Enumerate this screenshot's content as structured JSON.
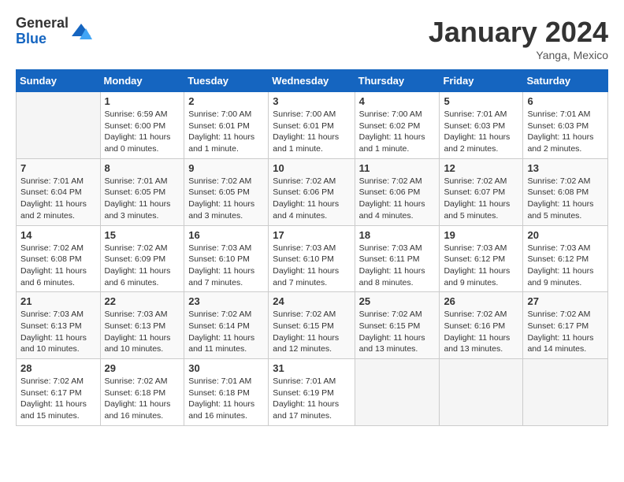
{
  "logo": {
    "general": "General",
    "blue": "Blue"
  },
  "title": "January 2024",
  "location": "Yanga, Mexico",
  "days_of_week": [
    "Sunday",
    "Monday",
    "Tuesday",
    "Wednesday",
    "Thursday",
    "Friday",
    "Saturday"
  ],
  "weeks": [
    [
      {
        "day": "",
        "info": ""
      },
      {
        "day": "1",
        "info": "Sunrise: 6:59 AM\nSunset: 6:00 PM\nDaylight: 11 hours\nand 0 minutes."
      },
      {
        "day": "2",
        "info": "Sunrise: 7:00 AM\nSunset: 6:01 PM\nDaylight: 11 hours\nand 1 minute."
      },
      {
        "day": "3",
        "info": "Sunrise: 7:00 AM\nSunset: 6:01 PM\nDaylight: 11 hours\nand 1 minute."
      },
      {
        "day": "4",
        "info": "Sunrise: 7:00 AM\nSunset: 6:02 PM\nDaylight: 11 hours\nand 1 minute."
      },
      {
        "day": "5",
        "info": "Sunrise: 7:01 AM\nSunset: 6:03 PM\nDaylight: 11 hours\nand 2 minutes."
      },
      {
        "day": "6",
        "info": "Sunrise: 7:01 AM\nSunset: 6:03 PM\nDaylight: 11 hours\nand 2 minutes."
      }
    ],
    [
      {
        "day": "7",
        "info": "Sunrise: 7:01 AM\nSunset: 6:04 PM\nDaylight: 11 hours\nand 2 minutes."
      },
      {
        "day": "8",
        "info": "Sunrise: 7:01 AM\nSunset: 6:05 PM\nDaylight: 11 hours\nand 3 minutes."
      },
      {
        "day": "9",
        "info": "Sunrise: 7:02 AM\nSunset: 6:05 PM\nDaylight: 11 hours\nand 3 minutes."
      },
      {
        "day": "10",
        "info": "Sunrise: 7:02 AM\nSunset: 6:06 PM\nDaylight: 11 hours\nand 4 minutes."
      },
      {
        "day": "11",
        "info": "Sunrise: 7:02 AM\nSunset: 6:06 PM\nDaylight: 11 hours\nand 4 minutes."
      },
      {
        "day": "12",
        "info": "Sunrise: 7:02 AM\nSunset: 6:07 PM\nDaylight: 11 hours\nand 5 minutes."
      },
      {
        "day": "13",
        "info": "Sunrise: 7:02 AM\nSunset: 6:08 PM\nDaylight: 11 hours\nand 5 minutes."
      }
    ],
    [
      {
        "day": "14",
        "info": "Sunrise: 7:02 AM\nSunset: 6:08 PM\nDaylight: 11 hours\nand 6 minutes."
      },
      {
        "day": "15",
        "info": "Sunrise: 7:02 AM\nSunset: 6:09 PM\nDaylight: 11 hours\nand 6 minutes."
      },
      {
        "day": "16",
        "info": "Sunrise: 7:03 AM\nSunset: 6:10 PM\nDaylight: 11 hours\nand 7 minutes."
      },
      {
        "day": "17",
        "info": "Sunrise: 7:03 AM\nSunset: 6:10 PM\nDaylight: 11 hours\nand 7 minutes."
      },
      {
        "day": "18",
        "info": "Sunrise: 7:03 AM\nSunset: 6:11 PM\nDaylight: 11 hours\nand 8 minutes."
      },
      {
        "day": "19",
        "info": "Sunrise: 7:03 AM\nSunset: 6:12 PM\nDaylight: 11 hours\nand 9 minutes."
      },
      {
        "day": "20",
        "info": "Sunrise: 7:03 AM\nSunset: 6:12 PM\nDaylight: 11 hours\nand 9 minutes."
      }
    ],
    [
      {
        "day": "21",
        "info": "Sunrise: 7:03 AM\nSunset: 6:13 PM\nDaylight: 11 hours\nand 10 minutes."
      },
      {
        "day": "22",
        "info": "Sunrise: 7:03 AM\nSunset: 6:13 PM\nDaylight: 11 hours\nand 10 minutes."
      },
      {
        "day": "23",
        "info": "Sunrise: 7:02 AM\nSunset: 6:14 PM\nDaylight: 11 hours\nand 11 minutes."
      },
      {
        "day": "24",
        "info": "Sunrise: 7:02 AM\nSunset: 6:15 PM\nDaylight: 11 hours\nand 12 minutes."
      },
      {
        "day": "25",
        "info": "Sunrise: 7:02 AM\nSunset: 6:15 PM\nDaylight: 11 hours\nand 13 minutes."
      },
      {
        "day": "26",
        "info": "Sunrise: 7:02 AM\nSunset: 6:16 PM\nDaylight: 11 hours\nand 13 minutes."
      },
      {
        "day": "27",
        "info": "Sunrise: 7:02 AM\nSunset: 6:17 PM\nDaylight: 11 hours\nand 14 minutes."
      }
    ],
    [
      {
        "day": "28",
        "info": "Sunrise: 7:02 AM\nSunset: 6:17 PM\nDaylight: 11 hours\nand 15 minutes."
      },
      {
        "day": "29",
        "info": "Sunrise: 7:02 AM\nSunset: 6:18 PM\nDaylight: 11 hours\nand 16 minutes."
      },
      {
        "day": "30",
        "info": "Sunrise: 7:01 AM\nSunset: 6:18 PM\nDaylight: 11 hours\nand 16 minutes."
      },
      {
        "day": "31",
        "info": "Sunrise: 7:01 AM\nSunset: 6:19 PM\nDaylight: 11 hours\nand 17 minutes."
      },
      {
        "day": "",
        "info": ""
      },
      {
        "day": "",
        "info": ""
      },
      {
        "day": "",
        "info": ""
      }
    ]
  ]
}
